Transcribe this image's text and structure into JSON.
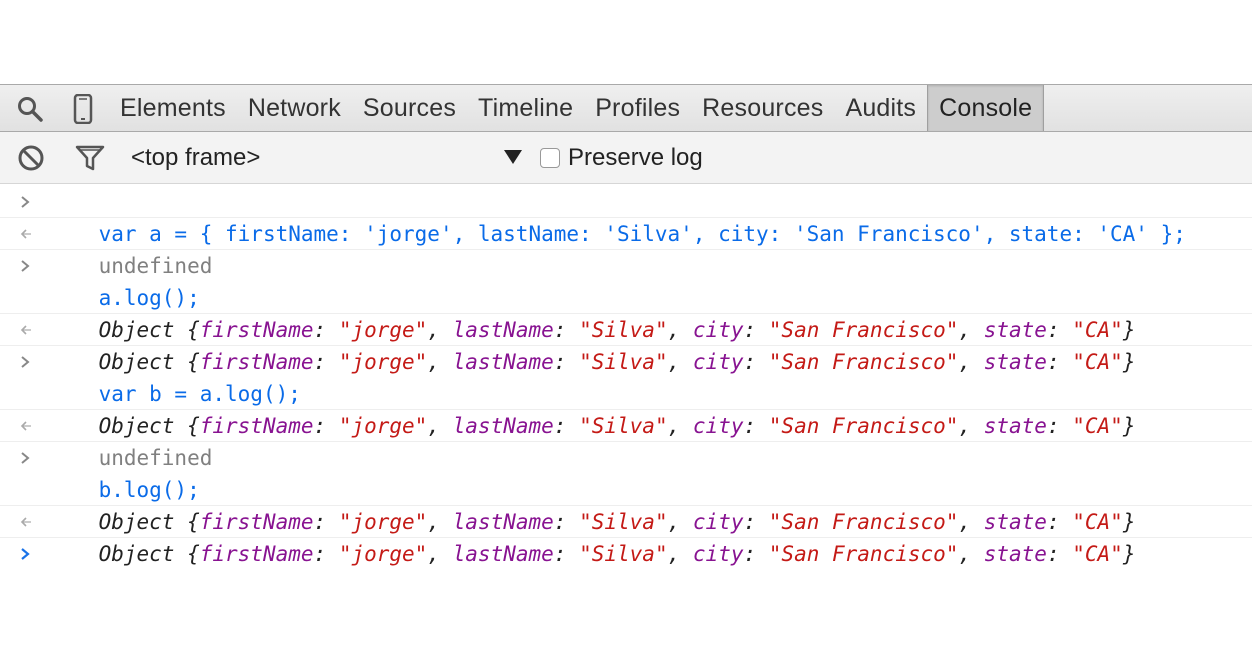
{
  "toolbar": {
    "tabs": [
      {
        "label": "Elements"
      },
      {
        "label": "Network"
      },
      {
        "label": "Sources"
      },
      {
        "label": "Timeline"
      },
      {
        "label": "Profiles"
      },
      {
        "label": "Resources"
      },
      {
        "label": "Audits"
      },
      {
        "label": "Console",
        "active": true
      }
    ],
    "icons": [
      "search-icon",
      "device-mode-icon"
    ]
  },
  "filterbar": {
    "frame": "<top frame>",
    "preserve_log_label": "Preserve log",
    "preserve_log_checked": false
  },
  "console": {
    "tokens": {
      "obj": "Object {",
      "k_first": "firstName",
      "k_last": "lastName",
      "k_city": "city",
      "k_state": "state",
      "v_first": "\"jorge\"",
      "v_last": "\"Silva\"",
      "v_city": "\"San Francisco\"",
      "v_state": "\"CA\"",
      "colon": ": ",
      "comma": ", ",
      "close": "}"
    },
    "rows": [
      {
        "type": "input",
        "text": "var a = { firstName: 'jorge', lastName: 'Silva', city: 'San Francisco', state: 'CA' };"
      },
      {
        "type": "result",
        "text": "undefined"
      },
      {
        "type": "input",
        "text": "a.log();"
      },
      {
        "type": "log",
        "text": "Object"
      },
      {
        "type": "result-object",
        "text": "Object"
      },
      {
        "type": "input",
        "text": "var b = a.log();"
      },
      {
        "type": "log",
        "text": "Object"
      },
      {
        "type": "result",
        "text": "undefined"
      },
      {
        "type": "input",
        "text": "b.log();"
      },
      {
        "type": "log",
        "text": "Object"
      },
      {
        "type": "result-object",
        "text": "Object"
      }
    ]
  },
  "colors": {
    "command": "#0a6be8",
    "key": "#881391",
    "string": "#c41a16",
    "undefined": "#808080"
  }
}
